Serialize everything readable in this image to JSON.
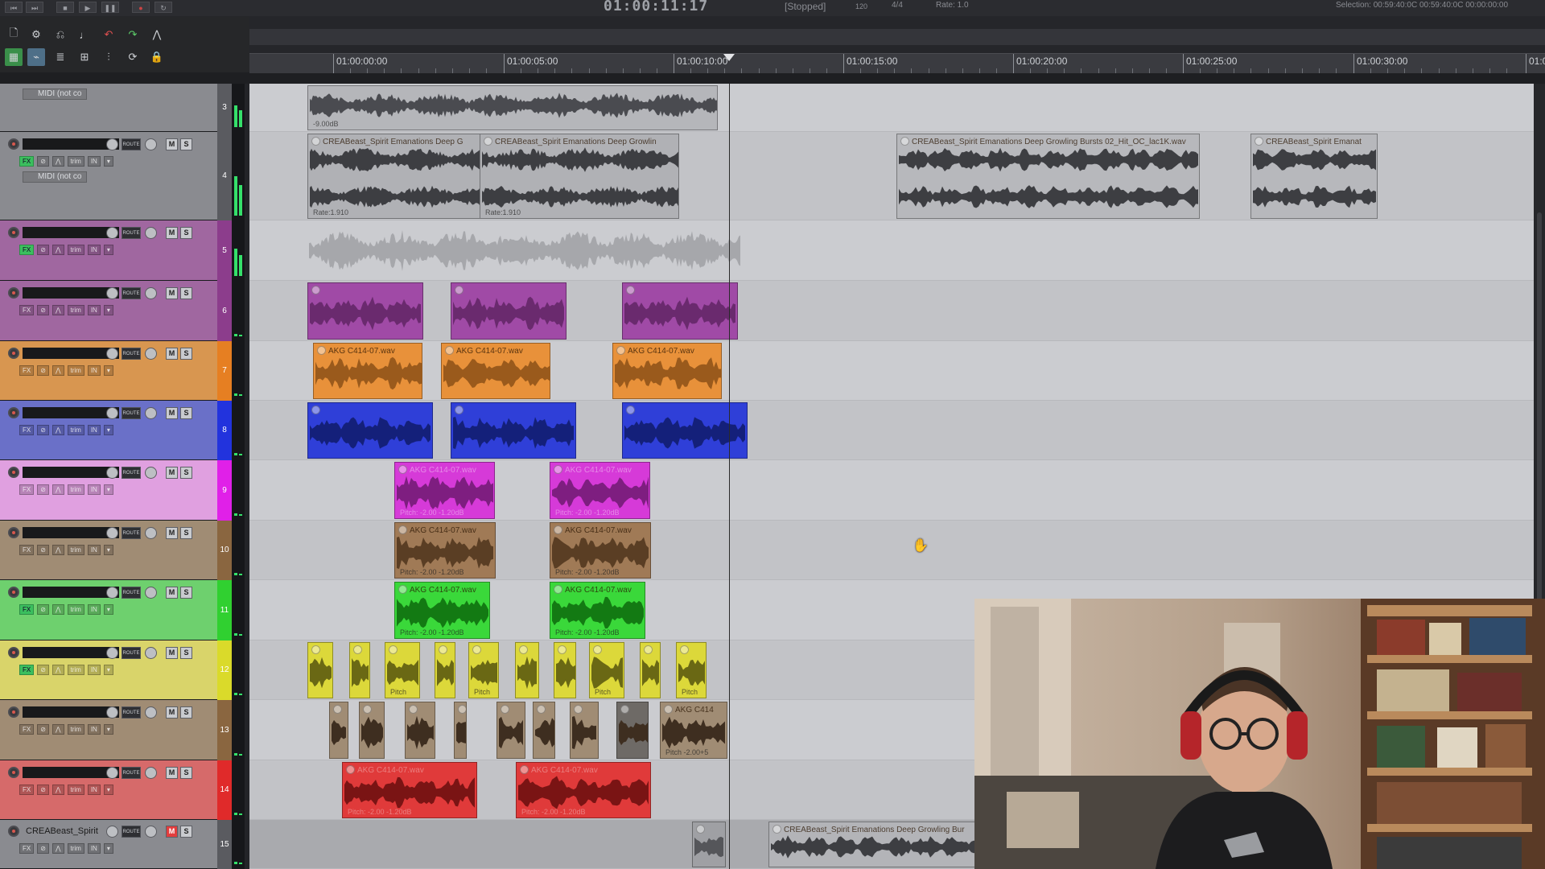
{
  "transport": {
    "time": "01:00:11:17",
    "status": "[Stopped]",
    "bpm": "120",
    "time_sig": "4/4",
    "rate": "Rate: 1.0",
    "selection": "Selection: 00:59:40:0C 00:59:40:0C 00:00:00:00"
  },
  "ruler": {
    "labels": [
      "01:00:00:00",
      "01:00:05:00",
      "01:00:10:00",
      "01:00:15:00",
      "01:00:20:00",
      "01:00:25:00",
      "01:00:30:00",
      "01:0"
    ]
  },
  "tracks": [
    {
      "num": "3",
      "color": "#8e8f93",
      "name": "",
      "midi": "MIDI (not co",
      "m_active": false
    },
    {
      "num": "4",
      "color": "#8e8f93",
      "name": "",
      "midi": "MIDI (not co",
      "m_active": false
    },
    {
      "num": "5",
      "color": "#8c3d8c",
      "name": "",
      "midi": "",
      "m_active": false
    },
    {
      "num": "6",
      "color": "#8c3d8c",
      "name": "",
      "midi": "",
      "m_active": false
    },
    {
      "num": "7",
      "color": "#e67f22",
      "name": "",
      "midi": "",
      "m_active": false
    },
    {
      "num": "8",
      "color": "#2233dd",
      "name": "",
      "midi": "",
      "m_active": false
    },
    {
      "num": "9",
      "color": "#e020e8",
      "name": "",
      "midi": "",
      "m_active": false
    },
    {
      "num": "10",
      "color": "#8a6640",
      "name": "",
      "midi": "",
      "m_active": false
    },
    {
      "num": "11",
      "color": "#30d030",
      "name": "",
      "midi": "",
      "m_active": false
    },
    {
      "num": "12",
      "color": "#dada2a",
      "name": "",
      "midi": "",
      "m_active": false
    },
    {
      "num": "13",
      "color": "#8a6640",
      "name": "",
      "midi": "",
      "m_active": false
    },
    {
      "num": "14",
      "color": "#e02a2a",
      "name": "",
      "midi": "",
      "m_active": false
    },
    {
      "num": "15",
      "color": "#8e8f93",
      "name": "CREABeast_Spirit",
      "midi": "",
      "m_active": true
    }
  ],
  "tcp_labels": {
    "m": "M",
    "s": "S",
    "route": "ROUTE",
    "fx": "FX",
    "trim": "trim",
    "in": "IN"
  },
  "items": {
    "t3_gain": "-9.00dB",
    "t4_a": "CREABeast_Spirit Emanations Deep G",
    "t4_b": "CREABeast_Spirit Emanations Deep Growlin",
    "t4_c": "CREABeast_Spirit Emanations Deep Growling Bursts 02_Hit_OC_lac1K.wav",
    "t4_d": "CREABeast_Spirit Emanat",
    "t4_rate": "Rate:1.910",
    "akg": "AKG C414-07.wav",
    "pitch": "Pitch: -2.00 -1.20dB",
    "pitch_short": "Pitch",
    "pitch_13": "Pitch -2.00+5",
    "akg_short": "AKG C414",
    "t15_a": "CREABeast_Spirit Emanations Deep Growling Bur"
  }
}
